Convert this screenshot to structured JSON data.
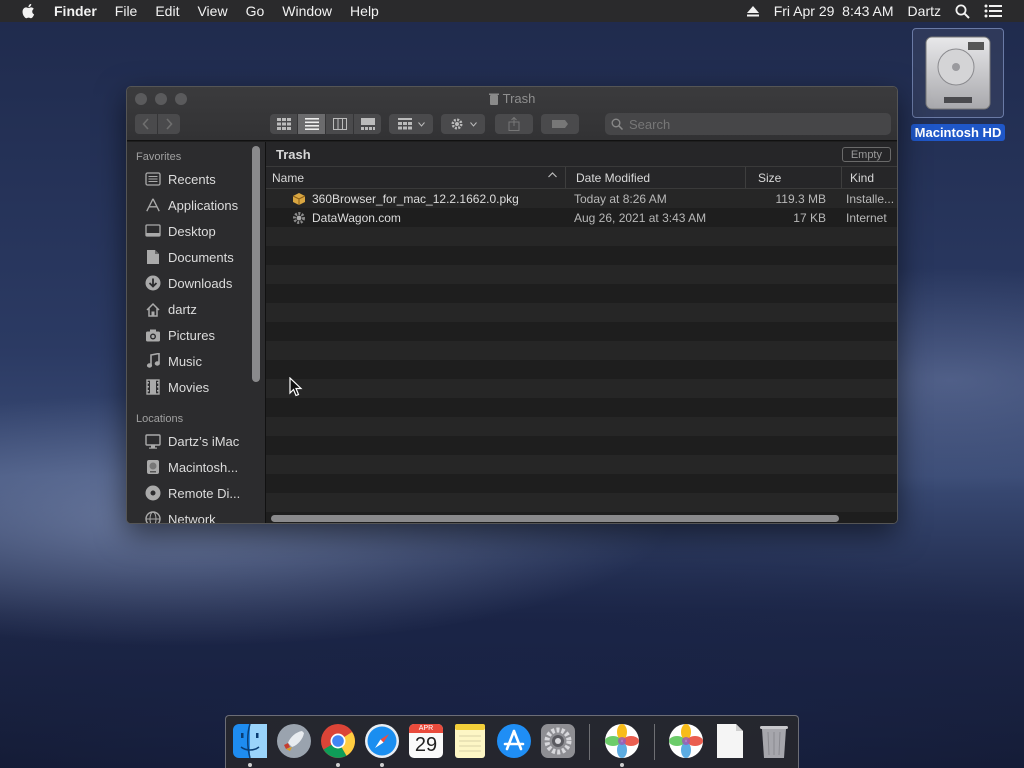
{
  "menubar": {
    "app_name": "Finder",
    "menus": [
      "File",
      "Edit",
      "View",
      "Go",
      "Window",
      "Help"
    ],
    "datetime": "Fri Apr 29  8:43 AM",
    "user": "Dartz"
  },
  "desktop": {
    "drive_label": "Macintosh HD"
  },
  "window": {
    "title": "Trash",
    "search_placeholder": "Search",
    "path_title": "Trash",
    "empty_label": "Empty",
    "columns": {
      "name": "Name",
      "date": "Date Modified",
      "size": "Size",
      "kind": "Kind"
    },
    "files": [
      {
        "name": "360Browser_for_mac_12.2.1662.0.pkg",
        "date": "Today at 8:26 AM",
        "size": "119.3 MB",
        "kind": "Installe...",
        "icon": "package-icon"
      },
      {
        "name": "DataWagon.com",
        "date": "Aug 26, 2021 at 3:43 AM",
        "size": "17 KB",
        "kind": "Internet",
        "icon": "gear-file-icon"
      }
    ]
  },
  "sidebar": {
    "favorites_label": "Favorites",
    "favorites": [
      {
        "label": "Recents",
        "icon": "recents-icon"
      },
      {
        "label": "Applications",
        "icon": "applications-icon"
      },
      {
        "label": "Desktop",
        "icon": "desktop-icon"
      },
      {
        "label": "Documents",
        "icon": "documents-icon"
      },
      {
        "label": "Downloads",
        "icon": "downloads-icon"
      },
      {
        "label": "dartz",
        "icon": "home-icon"
      },
      {
        "label": "Pictures",
        "icon": "pictures-icon"
      },
      {
        "label": "Music",
        "icon": "music-icon"
      },
      {
        "label": "Movies",
        "icon": "movies-icon"
      }
    ],
    "locations_label": "Locations",
    "locations": [
      {
        "label": "Dartz’s iMac",
        "icon": "imac-icon"
      },
      {
        "label": "Macintosh...",
        "icon": "disk-icon"
      },
      {
        "label": "Remote Di...",
        "icon": "remote-disc-icon"
      },
      {
        "label": "Network",
        "icon": "network-icon"
      }
    ]
  },
  "dock": {
    "apps": [
      "Finder",
      "Launchpad",
      "Chrome",
      "Safari",
      "Calendar",
      "Notes",
      "App Store",
      "System Preferences",
      "Photos App",
      "Photos App",
      "Document",
      "Trash"
    ],
    "calendar": {
      "month": "APR",
      "day": "29"
    }
  }
}
